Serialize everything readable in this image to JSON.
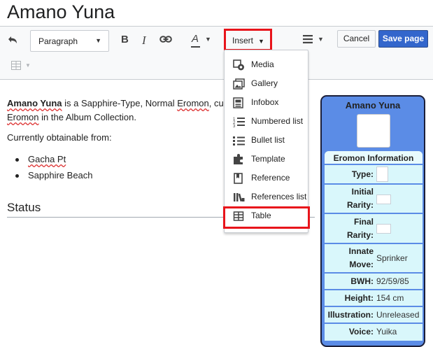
{
  "page": {
    "title": "Amano Yuna"
  },
  "toolbar": {
    "format_value": "Paragraph",
    "insert_label": "Insert",
    "cancel_label": "Cancel",
    "save_label": "Save page",
    "accent_color": "#3366cc",
    "highlight_color": "#e8141b",
    "icons": [
      "undo-icon",
      "bold-icon",
      "italic-icon",
      "link-icon",
      "text-style-icon",
      "list-menu-icon",
      "table-icon"
    ]
  },
  "insert_menu": {
    "items": [
      {
        "label": "Media",
        "icon": "media-icon"
      },
      {
        "label": "Gallery",
        "icon": "gallery-icon"
      },
      {
        "label": "Infobox",
        "icon": "infobox-icon"
      },
      {
        "label": "Numbered list",
        "icon": "numbered-list-icon"
      },
      {
        "label": "Bullet list",
        "icon": "bullet-list-icon"
      },
      {
        "label": "Template",
        "icon": "template-icon"
      },
      {
        "label": "Reference",
        "icon": "reference-icon"
      },
      {
        "label": "References list",
        "icon": "references-list-icon"
      },
      {
        "label": "Table",
        "icon": "table-icon"
      }
    ]
  },
  "article": {
    "lead_name": "Amano Yuna",
    "lead_text_1": " is a Sapphire-Type, Normal ",
    "lead_link_1": "Eromon",
    "lead_text_2": ", curre",
    "lead_link_2": "Eromon",
    "lead_text_3": " in the Album Collection.",
    "obtainable_intro": "Currently obtainable from:",
    "sources": [
      "Gacha Pt",
      "Sapphire Beach"
    ],
    "status_heading": "Status"
  },
  "infobox": {
    "name": "Amano Yuna",
    "section": "Eromon Information",
    "type_label": "Type:",
    "initial_rarity_line1": "Initial",
    "initial_rarity_line2": "Rarity:",
    "final_rarity_line1": "Final",
    "final_rarity_line2": "Rarity:",
    "innate_line1": "Innate",
    "innate_line2": "Move:",
    "innate_value": "Sprinker",
    "bwh_label": "BWH:",
    "bwh_value": "92/59/85",
    "height_label": "Height:",
    "height_value": "154 cm",
    "illustration_label": "Illustration:",
    "illustration_value": "Unreleased",
    "voice_label": "Voice:",
    "voice_value": "Yuika",
    "bg_color": "#5b8ce6",
    "cell_color": "#d9f7fb"
  }
}
